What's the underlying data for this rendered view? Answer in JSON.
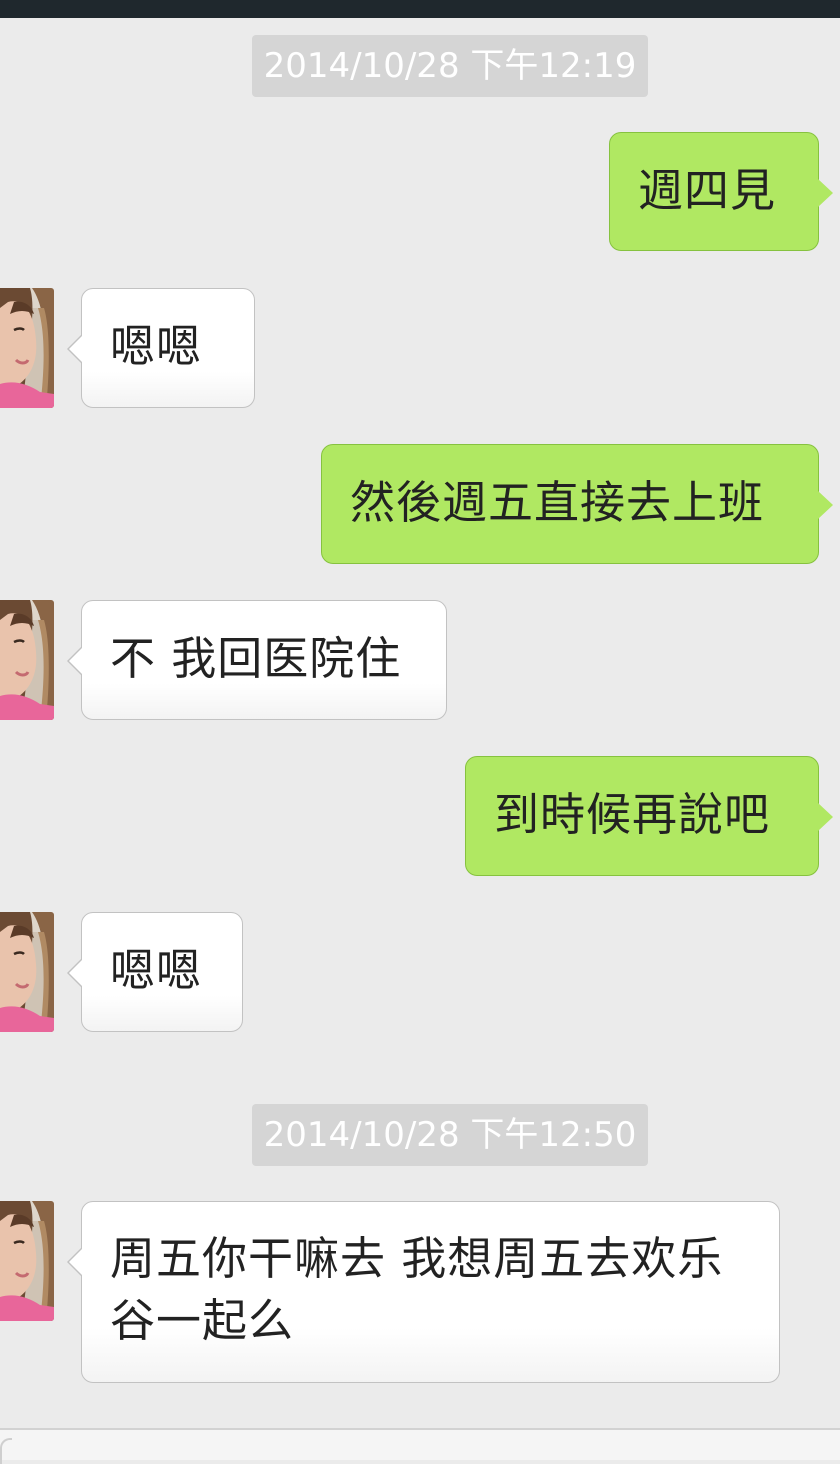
{
  "chat": {
    "timestamps": [
      "2014/10/28 下午12:19",
      "2014/10/28 下午12:50"
    ],
    "messages": [
      {
        "direction": "outgoing",
        "text": "週四見"
      },
      {
        "direction": "incoming",
        "text": "嗯嗯"
      },
      {
        "direction": "outgoing",
        "text": "然後週五直接去上班"
      },
      {
        "direction": "incoming",
        "text": "不 我回医院住"
      },
      {
        "direction": "outgoing",
        "text": "到時候再說吧"
      },
      {
        "direction": "incoming",
        "text": "嗯嗯"
      },
      {
        "direction": "incoming",
        "text": "周五你干嘛去 我想周五去欢乐谷一起么"
      }
    ]
  },
  "colors": {
    "background": "#ebebeb",
    "outgoing_bubble": "#b0e862",
    "incoming_bubble": "#ffffff",
    "timestamp_pill": "#d5d5d5",
    "status_bar": "#1f282d"
  },
  "icons": {
    "avatar": "contact-avatar-photo"
  }
}
